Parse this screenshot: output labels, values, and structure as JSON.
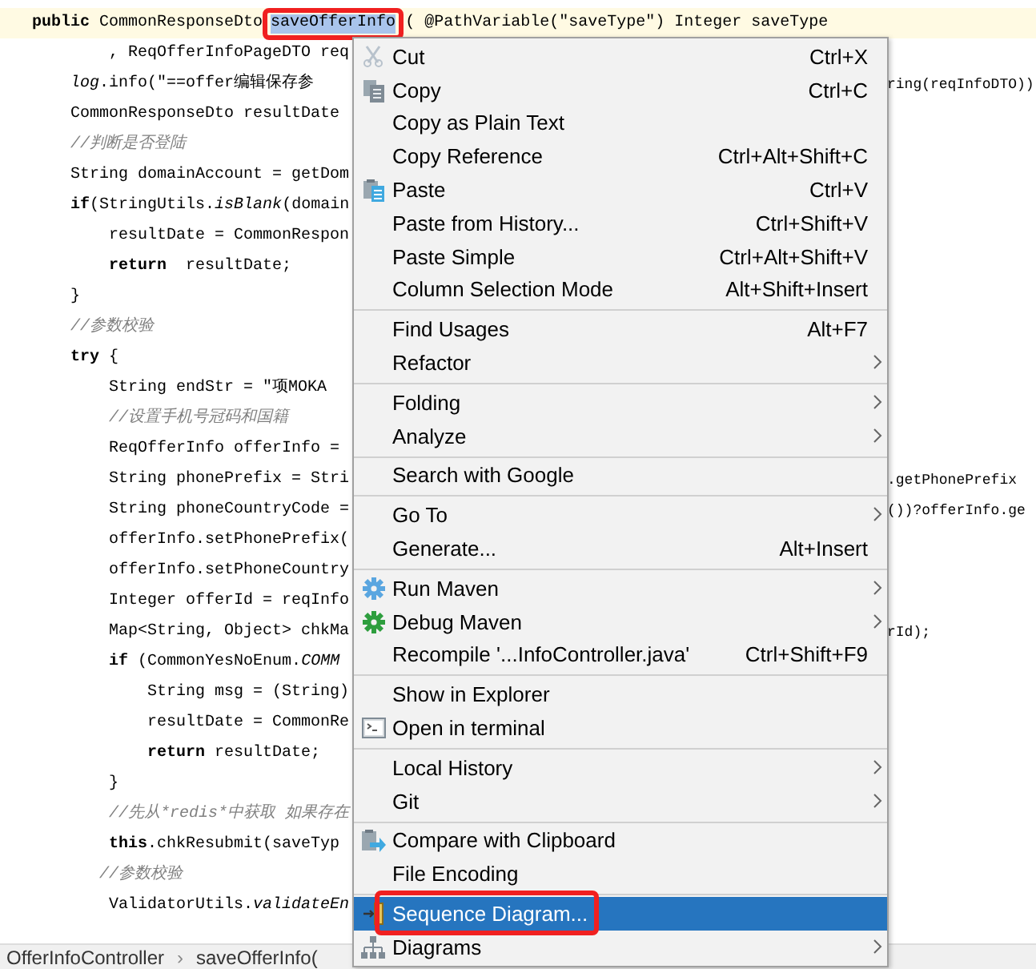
{
  "code_lines": [
    {
      "kind": "code",
      "current": true,
      "text": "**public** CommonResponseDto ",
      "selection": "saveOfferInfo",
      "after": "( @PathVariable(\"saveType\") Integer saveType"
    },
    {
      "kind": "code",
      "text": "        , ReqOfferInfoPageDTO req"
    },
    {
      "kind": "code",
      "text": "    *log*.info(\"==offer编辑保存参",
      "right": "ring(reqInfoDTO))"
    },
    {
      "kind": "code",
      "text": "    CommonResponseDto resultDate"
    },
    {
      "kind": "comment",
      "text": "    //判断是否登陆"
    },
    {
      "kind": "code",
      "text": "    String domainAccount = getDom"
    },
    {
      "kind": "code",
      "text": "    **if**(StringUtils.*isBlank*(domain"
    },
    {
      "kind": "code",
      "text": "        resultDate = CommonRespon"
    },
    {
      "kind": "code",
      "text": "        **return**  resultDate;"
    },
    {
      "kind": "code",
      "text": "    }"
    },
    {
      "kind": "comment",
      "text": "    //参数校验"
    },
    {
      "kind": "code",
      "text": "    **try** {"
    },
    {
      "kind": "code",
      "text": "        String endStr = \"项MOKA"
    },
    {
      "kind": "comment",
      "text": "        //设置手机号冠码和国籍"
    },
    {
      "kind": "code",
      "text": "        ReqOfferInfo offerInfo ="
    },
    {
      "kind": "code",
      "text": "        String phonePrefix = Stri",
      "right": ".getPhonePrefix"
    },
    {
      "kind": "code",
      "text": "        String phoneCountryCode =",
      "right": "())?offerInfo.ge"
    },
    {
      "kind": "code",
      "text": "        offerInfo.setPhonePrefix("
    },
    {
      "kind": "code",
      "text": "        offerInfo.setPhoneCountry"
    },
    {
      "kind": "code",
      "text": "        Integer offerId = reqInfo"
    },
    {
      "kind": "code",
      "text": "        Map<String, Object> chkMa",
      "right": "rId);"
    },
    {
      "kind": "code",
      "text": "        **if** (CommonYesNoEnum.*COMM*"
    },
    {
      "kind": "code",
      "text": "            String msg = (String)"
    },
    {
      "kind": "code",
      "text": "            resultDate = CommonRe"
    },
    {
      "kind": "code",
      "text": "            **return** resultDate;"
    },
    {
      "kind": "code",
      "text": "        }"
    },
    {
      "kind": "comment",
      "text": "        //先从*redis*中获取 如果存在"
    },
    {
      "kind": "code",
      "text": "        **this**.chkResubmit(saveTyp"
    },
    {
      "kind": "comment",
      "text": "       //参数校验"
    },
    {
      "kind": "code",
      "text": "        ValidatorUtils.*validateEn*"
    }
  ],
  "context_menu": [
    {
      "kind": "cut",
      "label": "Cut",
      "shortcut": "Ctrl+X",
      "selected": false
    },
    {
      "kind": "copy",
      "label": "Copy",
      "shortcut": "Ctrl+C",
      "selected": false
    },
    {
      "kind": "item",
      "label": "Copy as Plain Text",
      "selected": false
    },
    {
      "kind": "item",
      "label": "Copy Reference",
      "shortcut": "Ctrl+Alt+Shift+C",
      "selected": false
    },
    {
      "kind": "paste",
      "label": "Paste",
      "shortcut": "Ctrl+V",
      "selected": false
    },
    {
      "kind": "item",
      "label": "Paste from History...",
      "shortcut": "Ctrl+Shift+V",
      "selected": false
    },
    {
      "kind": "item",
      "label": "Paste Simple",
      "shortcut": "Ctrl+Alt+Shift+V",
      "selected": false
    },
    {
      "kind": "item",
      "label": "Column Selection Mode",
      "shortcut": "Alt+Shift+Insert",
      "selected": false
    },
    {
      "kind": "separator"
    },
    {
      "kind": "item",
      "label": "Find Usages",
      "shortcut": "Alt+F7",
      "selected": false
    },
    {
      "kind": "item",
      "label": "Refactor",
      "submenu": true,
      "selected": false
    },
    {
      "kind": "separator"
    },
    {
      "kind": "item",
      "label": "Folding",
      "submenu": true,
      "selected": false
    },
    {
      "kind": "item",
      "label": "Analyze",
      "submenu": true,
      "selected": false
    },
    {
      "kind": "separator"
    },
    {
      "kind": "item",
      "label": "Search with Google",
      "selected": false
    },
    {
      "kind": "separator"
    },
    {
      "kind": "item",
      "label": "Go To",
      "submenu": true,
      "selected": false
    },
    {
      "kind": "item",
      "label": "Generate...",
      "shortcut": "Alt+Insert",
      "selected": false
    },
    {
      "kind": "separator"
    },
    {
      "kind": "run",
      "label": "Run Maven",
      "submenu": true,
      "selected": false
    },
    {
      "kind": "debug",
      "label": "Debug Maven",
      "submenu": true,
      "selected": false
    },
    {
      "kind": "item",
      "label": "Recompile '...InfoController.java'",
      "shortcut": "Ctrl+Shift+F9",
      "selected": false
    },
    {
      "kind": "separator"
    },
    {
      "kind": "item",
      "label": "Show in Explorer",
      "selected": false
    },
    {
      "kind": "terminal",
      "label": "Open in terminal",
      "selected": false
    },
    {
      "kind": "separator"
    },
    {
      "kind": "item",
      "label": "Local History",
      "submenu": true,
      "selected": false
    },
    {
      "kind": "item",
      "label": "Git",
      "submenu": true,
      "selected": false
    },
    {
      "kind": "separator"
    },
    {
      "kind": "compare",
      "label": "Compare with Clipboard",
      "selected": false
    },
    {
      "kind": "item",
      "label": "File Encoding",
      "selected": false
    },
    {
      "kind": "separator"
    },
    {
      "kind": "sequence",
      "label": "Sequence Diagram...",
      "selected": true
    },
    {
      "kind": "diagrams",
      "label": "Diagrams",
      "submenu": true,
      "selected": false
    }
  ],
  "breadcrumbs": [
    "OfferInfoController",
    "›",
    "saveOfferInfo("
  ]
}
